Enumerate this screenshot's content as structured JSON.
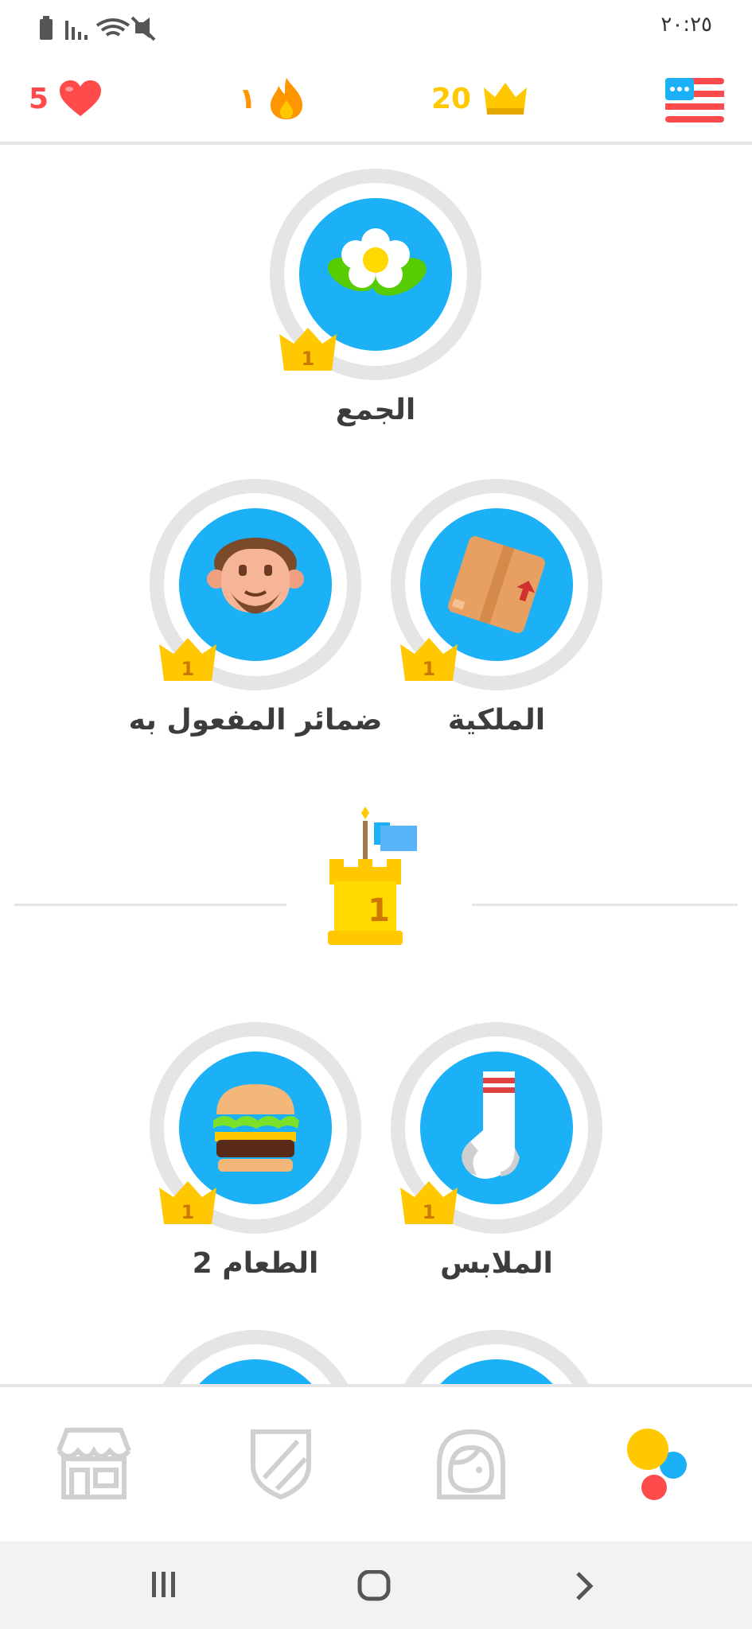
{
  "status_bar": {
    "time": "٢٠:٢٥"
  },
  "header": {
    "hearts": "5",
    "streak": "١",
    "crowns": "20",
    "flag": "US flag"
  },
  "skills": [
    {
      "label": "الجمع",
      "crown_level": "1",
      "icon": "flower-icon"
    },
    {
      "label": "ضمائر المفعول به",
      "crown_level": "1",
      "icon": "man-face-icon"
    },
    {
      "label": "الملكية",
      "crown_level": "1",
      "icon": "box-icon"
    },
    {
      "label": "الطعام 2",
      "crown_level": "1",
      "icon": "burger-icon"
    },
    {
      "label": "الملابس",
      "crown_level": "1",
      "icon": "sock-icon"
    }
  ],
  "checkpoint": {
    "level": "1"
  },
  "bottom_nav": [
    "shop-icon",
    "leagues-shield-icon",
    "profile-icon",
    "learn-icon"
  ],
  "colors": {
    "heart": "#ff4b4b",
    "streak": "#ff9600",
    "crown": "#ffc800",
    "skill_blue": "#1cb0f6",
    "ring_gray": "#e5e5e5"
  }
}
